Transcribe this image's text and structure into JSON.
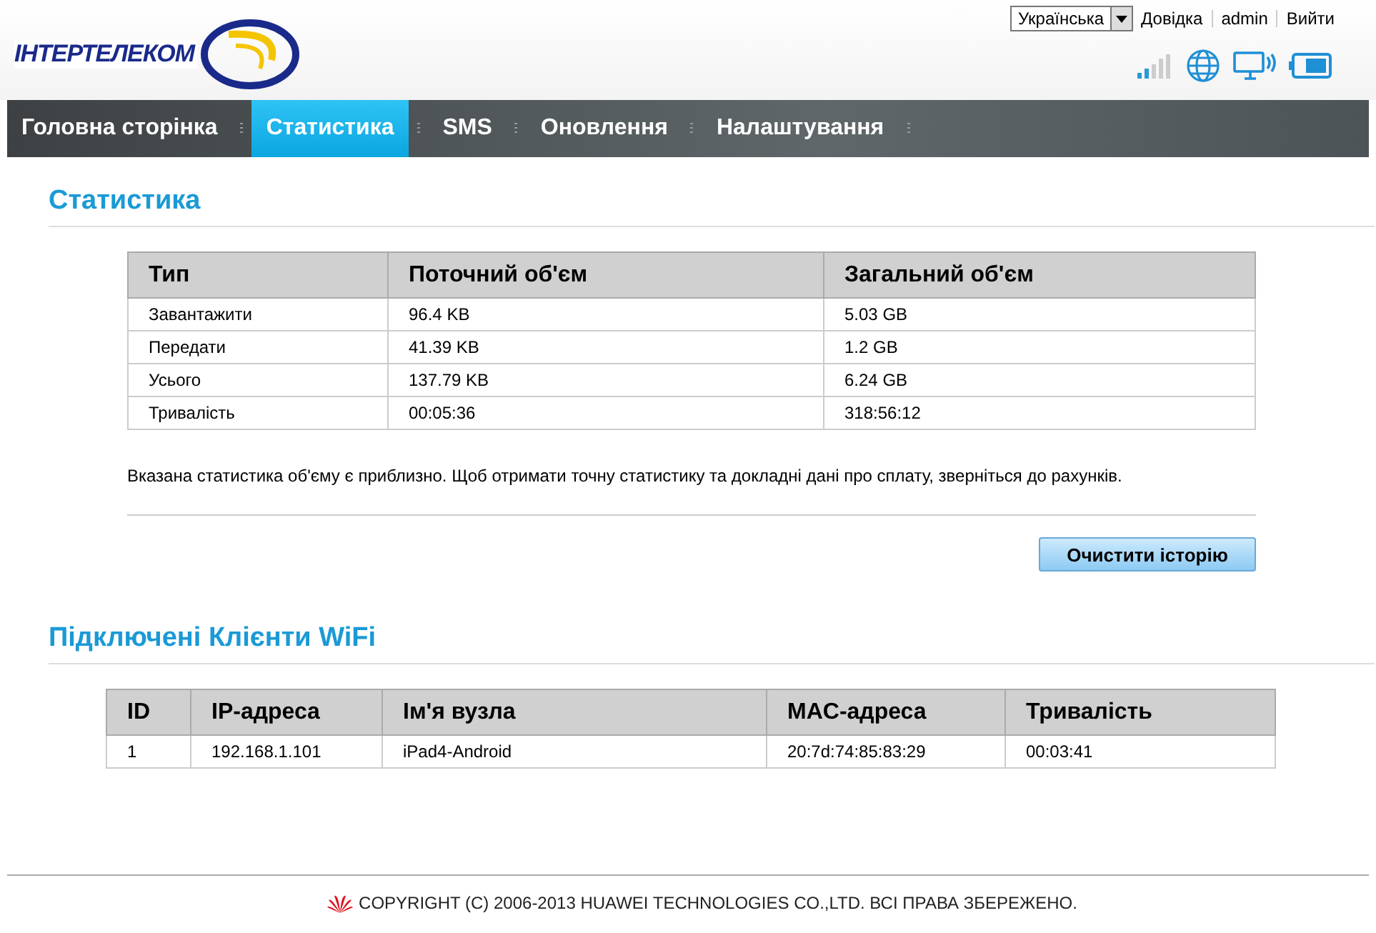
{
  "header": {
    "logo": "ІНТЕРТЕЛЕКОМ",
    "language": "Українська",
    "links": [
      "Довідка",
      "admin",
      "Вийти"
    ]
  },
  "nav": [
    {
      "label": "Головна сторінка",
      "selected": false
    },
    {
      "label": "Статистика",
      "selected": true
    },
    {
      "label": "SMS",
      "selected": false
    },
    {
      "label": "Оновлення",
      "selected": false
    },
    {
      "label": "Налаштування",
      "selected": false
    }
  ],
  "statistics": {
    "title": "Статистика",
    "columns": [
      "Тип",
      "Поточний об'єм",
      "Загальний об'єм"
    ],
    "rows": [
      [
        "Завантажити",
        "96.4 KB",
        "5.03 GB"
      ],
      [
        "Передати",
        "41.39 KB",
        "1.2 GB"
      ],
      [
        "Усього",
        "137.79 KB",
        "6.24 GB"
      ],
      [
        "Тривалість",
        "00:05:36",
        "318:56:12"
      ]
    ],
    "note": "Вказана статистика об'єму є приблизно. Щоб отримати точну статистику та докладні дані про сплату, зверніться до рахунків.",
    "button": "Очистити історію"
  },
  "clients": {
    "title": "Підключені Клієнти WiFi",
    "columns": [
      "ID",
      "IP-адреса",
      "Ім'я вузла",
      "MAC-адреса",
      "Тривалість"
    ],
    "rows": [
      [
        "1",
        "192.168.1.101",
        "iPad4-Android",
        "20:7d:74:85:83:29",
        "00:03:41"
      ]
    ]
  },
  "footer": "COPYRIGHT (C) 2006-2013 HUAWEI TECHNOLOGIES CO.,LTD. ВСІ ПРАВА ЗБЕРЕЖЕНО."
}
